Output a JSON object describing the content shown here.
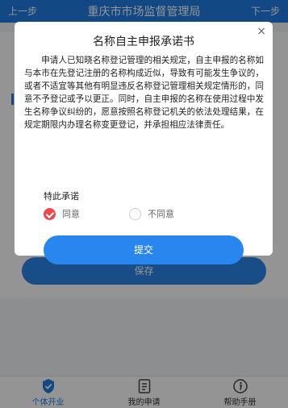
{
  "header": {
    "prev_label": "上一步",
    "title": "重庆市市场监督管理局",
    "next_label": "下一步"
  },
  "background": {
    "save_label": "保存"
  },
  "dialog": {
    "title": "名称自主申报承诺书",
    "close_glyph": "×",
    "body": "申请人已知晓名称登记管理的相关规定，自主申报的名称如与本市在先登记注册的名称构成近似，导致有可能发生争议的，或者不适宜等其他有明显违反名称登记管理相关规定情形的，同意不予登记或予以更正。同时，自主申报的名称在使用过程中发生名称争议纠纷的，愿意按照名称登记机关的依法处理结果，在规定期限内办理名称变更登记，并承担相应法律责任。",
    "tail": "特此承诺",
    "agree_label": "同意",
    "disagree_label": "不同意",
    "selected": "agree",
    "submit_label": "提交"
  },
  "tabbar": {
    "tabs": [
      {
        "label": "个体开业",
        "icon": "shield-check-icon",
        "active": true
      },
      {
        "label": "我的申请",
        "icon": "document-list-icon",
        "active": false
      },
      {
        "label": "帮助手册",
        "icon": "info-circle-icon",
        "active": false
      }
    ]
  },
  "colors": {
    "primary": "#1f7fe6",
    "checked_radio": "#ea4a4f",
    "mask": "rgba(0,0,0,0.42)"
  }
}
